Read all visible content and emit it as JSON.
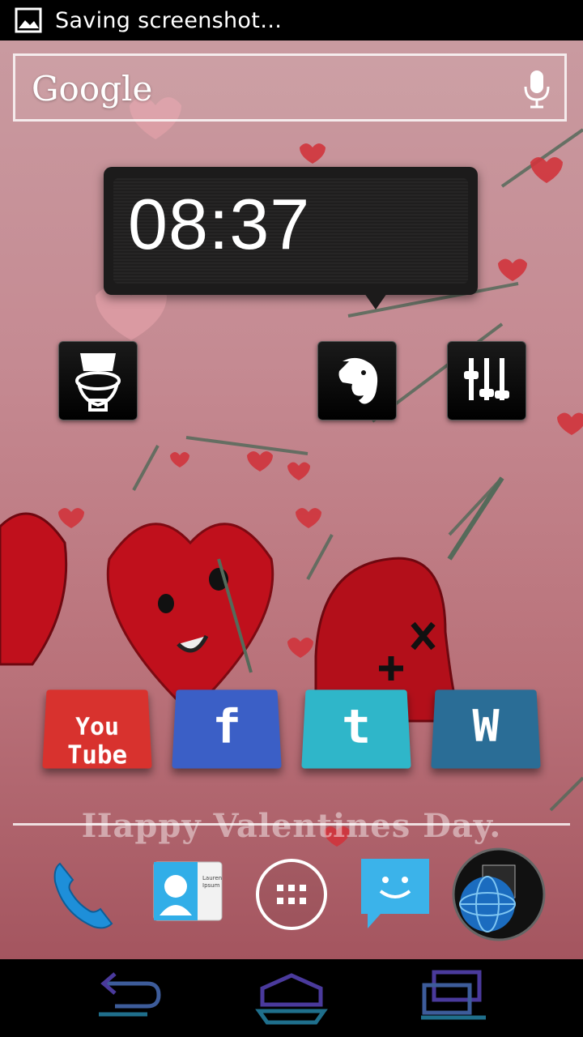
{
  "status_bar": {
    "notification_text": "Saving screenshot…",
    "icon": "image-icon"
  },
  "search_widget": {
    "logo_text": "Google",
    "mic_icon": "mic-icon"
  },
  "clock_widget": {
    "time": "08:37"
  },
  "home_shortcuts": [
    {
      "name": "toilet-app",
      "icon": "toilet-icon"
    },
    {
      "name": "evernote-app",
      "icon": "elephant-icon"
    },
    {
      "name": "settings-app",
      "icon": "equalizer-icon"
    }
  ],
  "led_icons": [
    {
      "name": "youtube",
      "label": "You Tube",
      "color": "#d8322e"
    },
    {
      "name": "facebook",
      "label": "f",
      "color": "#3b5fc6"
    },
    {
      "name": "twitter",
      "label": "t",
      "color": "#2fb6c9"
    },
    {
      "name": "wordpress",
      "label": "W",
      "color": "#2a6d96"
    }
  ],
  "wallpaper_text": "Happy Valentines Day.",
  "dock": [
    {
      "name": "phone",
      "icon": "phone-icon"
    },
    {
      "name": "people",
      "icon": "contacts-icon",
      "card_text": "Lauren Ipsum"
    },
    {
      "name": "apps",
      "icon": "apps-grid-icon"
    },
    {
      "name": "messaging",
      "icon": "smiley-chat-icon"
    },
    {
      "name": "browser",
      "icon": "globe-icon"
    }
  ],
  "navigation": [
    "back-icon",
    "home-icon",
    "recent-apps-icon"
  ]
}
